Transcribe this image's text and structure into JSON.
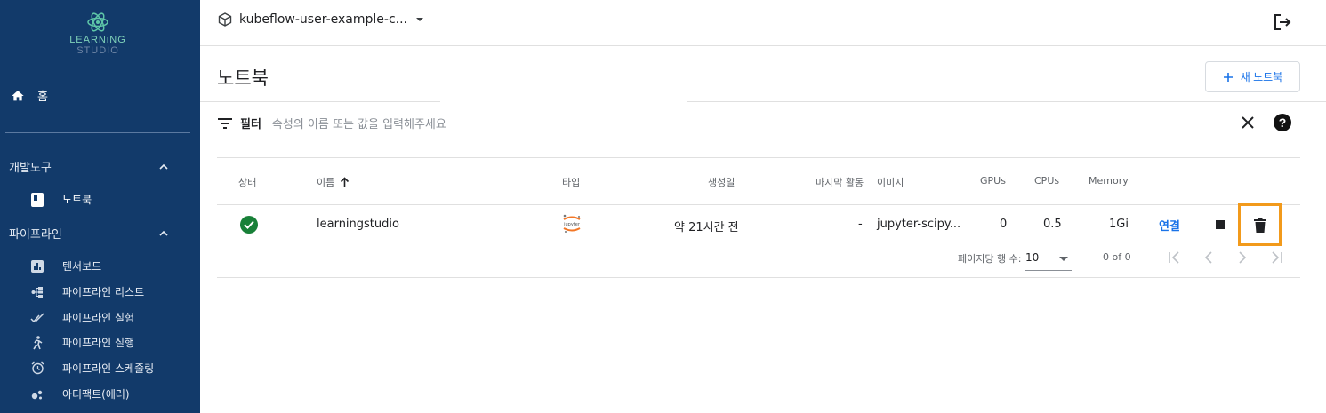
{
  "sidebar": {
    "logo_line1": "LEARNiNG",
    "logo_line2": "STUDIO",
    "home_label": "홈",
    "sections": [
      {
        "label": "개발도구",
        "items": [
          {
            "label": "노트북",
            "icon": "notebook-icon",
            "active": true
          }
        ]
      },
      {
        "label": "파이프라인",
        "items": [
          {
            "label": "텐서보드",
            "icon": "tensorboard-icon"
          },
          {
            "label": "파이프라인 리스트",
            "icon": "pipeline-list-icon"
          },
          {
            "label": "파이프라인 실험",
            "icon": "experiment-icon"
          },
          {
            "label": "파이프라인 실행",
            "icon": "run-icon"
          },
          {
            "label": "파이프라인 스케줄링",
            "icon": "alarm-icon"
          },
          {
            "label": "아티팩트(에러)",
            "icon": "artifact-icon"
          }
        ]
      }
    ]
  },
  "topbar": {
    "namespace": "kubeflow-user-example-c..."
  },
  "page": {
    "title": "노트북",
    "new_button": "새 노트북"
  },
  "filter": {
    "label": "필터",
    "placeholder": "속성의 이름 또는 값을 입력해주세요"
  },
  "table": {
    "columns": {
      "status": "상태",
      "name": "이름",
      "type": "타입",
      "created": "생성일",
      "last_activity": "마지막 활동",
      "image": "이미지",
      "gpus": "GPUs",
      "cpus": "CPUs",
      "memory": "Memory"
    },
    "rows": [
      {
        "status": "ready",
        "name": "learningstudio",
        "type_icon": "jupyter-icon",
        "created": "약 21시간 전",
        "last_activity": "-",
        "image": "jupyter-scipy...",
        "gpus": "0",
        "cpus": "0.5",
        "memory": "1Gi",
        "connect": "연결"
      }
    ]
  },
  "pagination": {
    "rows_per_page_label": "페이지당 행 수:",
    "rows_per_page": "10",
    "range": "0 of 0"
  },
  "colors": {
    "sidebar_bg": "#123a6a",
    "accent": "#1a73e8",
    "success": "#188038",
    "highlight": "#f29a1b"
  }
}
